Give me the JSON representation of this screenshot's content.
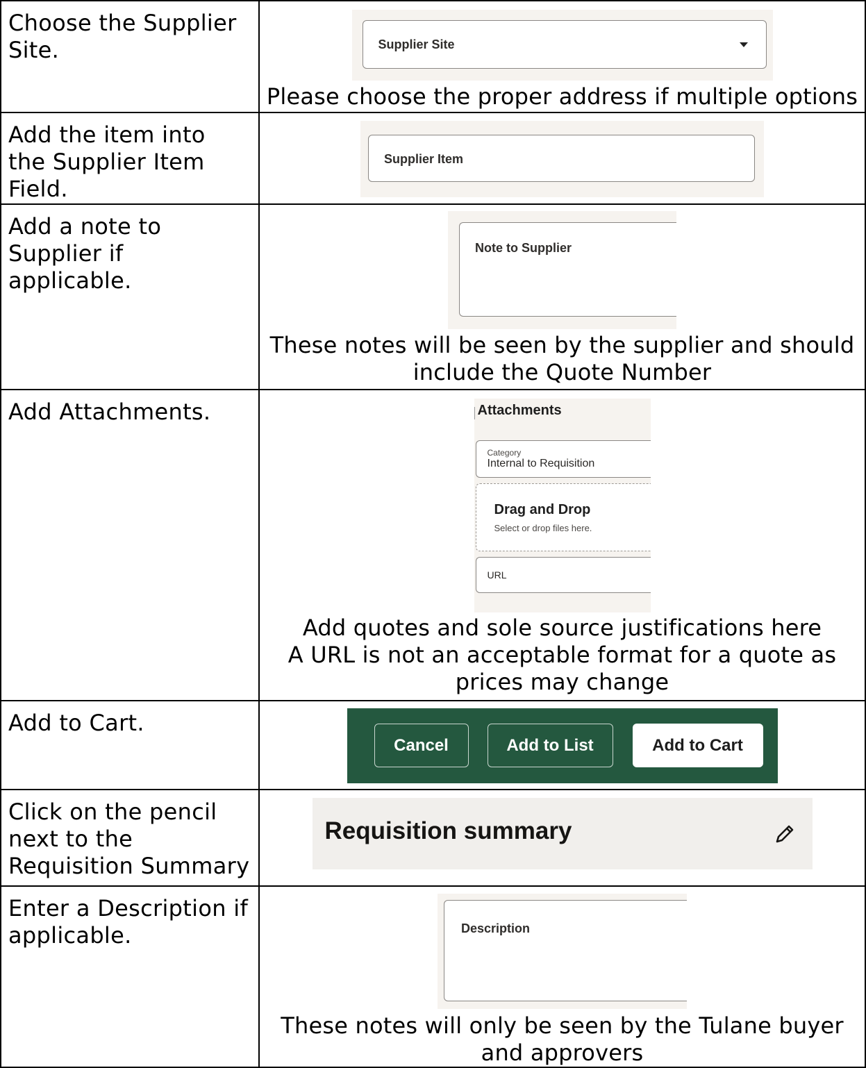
{
  "steps": [
    {
      "instruction": "Choose the Supplier Site.",
      "field_label": "Supplier Site",
      "note": "Please choose the proper address if multiple options"
    },
    {
      "instruction": "Add the item into the Supplier Item Field.",
      "field_label": "Supplier Item"
    },
    {
      "instruction": "Add a note to Supplier if applicable.",
      "field_label": "Note to Supplier",
      "note": "These notes will be seen by the supplier and should include the Quote Number"
    },
    {
      "instruction": "Add Attachments.",
      "attachments": {
        "heading": "Attachments",
        "category_label": "Category",
        "category_value": "Internal to Requisition",
        "drop_title": "Drag and Drop",
        "drop_hint": "Select or drop files here.",
        "url_label": "URL"
      },
      "note_lines": [
        "Add quotes and sole source justifications here",
        "A URL is not an acceptable format for a quote as prices may change"
      ]
    },
    {
      "instruction": "Add to Cart.",
      "buttons": [
        "Cancel",
        "Add to List",
        "Add to Cart"
      ]
    },
    {
      "instruction": "Click on the pencil next to the Requisition Summary",
      "heading": "Requisition summary",
      "icon": "pencil-icon"
    },
    {
      "instruction": "Enter a Description if applicable.",
      "field_label": "Description",
      "note": "These notes will only be seen by the Tulane buyer and approvers"
    }
  ],
  "colors": {
    "screenshot_bg": "#f6f3ef",
    "button_bar": "#24583f",
    "field_border": "#8a8784"
  }
}
